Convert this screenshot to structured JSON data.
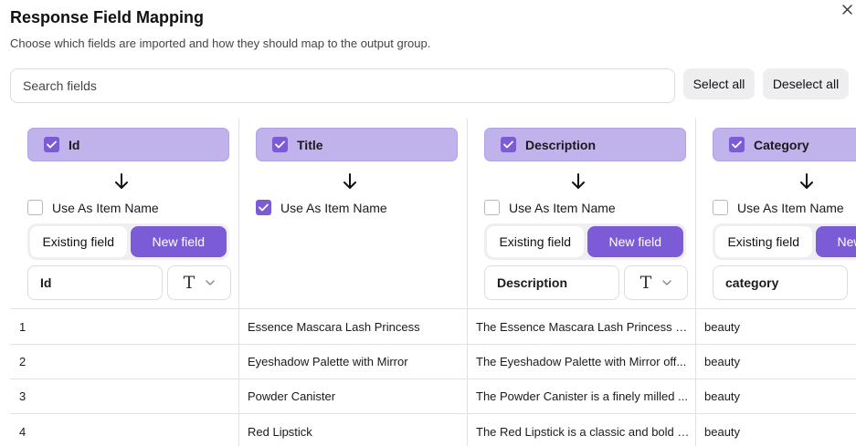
{
  "dialog": {
    "title": "Response Field Mapping",
    "subtitle": "Choose which fields are imported and how they should map to the output group.",
    "close_glyph": "✕"
  },
  "toolbar": {
    "search_placeholder": "Search fields",
    "select_all_label": "Select all",
    "deselect_all_label": "Deselect all"
  },
  "columns": [
    {
      "field": "Id",
      "checked": true,
      "use_as_item_name": false,
      "use_as_item_name_label": "Use As Item Name",
      "mode_options": [
        "Existing field",
        "New field"
      ],
      "active_mode": "New field",
      "new_field_name": "Id",
      "type_icon": "text-type-icon"
    },
    {
      "field": "Title",
      "checked": true,
      "use_as_item_name": true,
      "use_as_item_name_label": "Use As Item Name"
    },
    {
      "field": "Description",
      "checked": true,
      "use_as_item_name": false,
      "use_as_item_name_label": "Use As Item Name",
      "mode_options": [
        "Existing field",
        "New field"
      ],
      "active_mode": "New field",
      "new_field_name": "Description",
      "type_icon": "text-type-icon"
    },
    {
      "field": "Category",
      "checked": true,
      "use_as_item_name": false,
      "use_as_item_name_label": "Use As Item Name",
      "mode_options": [
        "Existing field",
        "New field"
      ],
      "active_mode": "New field",
      "new_field_name": "category",
      "type_icon": "text-type-icon"
    }
  ],
  "rows": [
    [
      "1",
      "Essence Mascara Lash Princess",
      "The Essence Mascara Lash Princess is ...",
      "beauty"
    ],
    [
      "2",
      "Eyeshadow Palette with Mirror",
      "The Eyeshadow Palette with Mirror off...",
      "beauty"
    ],
    [
      "3",
      "Powder Canister",
      "The Powder Canister is a finely milled ...",
      "beauty"
    ],
    [
      "4",
      "Red Lipstick",
      "The Red Lipstick is a classic and bold c...",
      "beauty"
    ]
  ],
  "colors": {
    "accent": "#7c5cd6",
    "chip": "#c0b2eb",
    "border": "#dcdce0",
    "button_bg": "#eeeef1"
  }
}
